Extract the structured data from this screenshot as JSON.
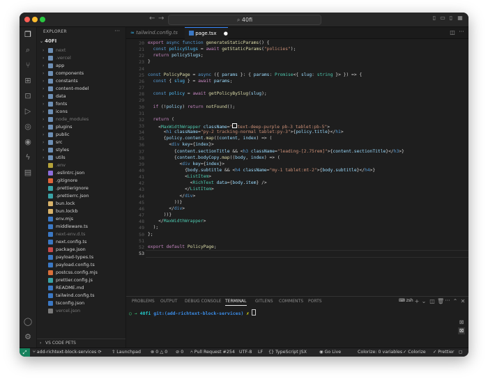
{
  "window": {
    "title": "40fi",
    "traffic": {
      "close": "#ff5f57",
      "min": "#febc2e",
      "max": "#28c840"
    }
  },
  "explorer": {
    "header": "EXPLORER",
    "root": "40FI",
    "items": [
      {
        "label": "next",
        "kind": "folder",
        "color": "#7a7a7a"
      },
      {
        "label": ".vercel",
        "kind": "folder",
        "color": "#7a7a7a"
      },
      {
        "label": "app",
        "kind": "folder",
        "color": "#d4d4d4"
      },
      {
        "label": "components",
        "kind": "folder",
        "color": "#d4d4d4"
      },
      {
        "label": "constants",
        "kind": "folder",
        "color": "#d4d4d4"
      },
      {
        "label": "content-model",
        "kind": "folder",
        "color": "#d4d4d4"
      },
      {
        "label": "data",
        "kind": "folder",
        "color": "#d4d4d4"
      },
      {
        "label": "fonts",
        "kind": "folder",
        "color": "#d4d4d4"
      },
      {
        "label": "icons",
        "kind": "folder",
        "color": "#d4d4d4"
      },
      {
        "label": "node_modules",
        "kind": "folder",
        "color": "#7a7a7a"
      },
      {
        "label": "plugins",
        "kind": "folder",
        "color": "#d4d4d4"
      },
      {
        "label": "public",
        "kind": "folder",
        "color": "#d4d4d4"
      },
      {
        "label": "src",
        "kind": "folder",
        "color": "#d4d4d4"
      },
      {
        "label": "styles",
        "kind": "folder",
        "color": "#d4d4d4"
      },
      {
        "label": "utils",
        "kind": "folder",
        "color": "#d4d4d4"
      },
      {
        "label": ".env",
        "kind": "file",
        "color": "#7a7a7a",
        "icon": "#b5a33a"
      },
      {
        "label": ".eslintrc.json",
        "kind": "file",
        "color": "#d4d4d4",
        "icon": "#8d6edb"
      },
      {
        "label": ".gitignore",
        "kind": "file",
        "color": "#d4d4d4",
        "icon": "#e0663b"
      },
      {
        "label": ".prettierignore",
        "kind": "file",
        "color": "#d4d4d4",
        "icon": "#3aa3a6"
      },
      {
        "label": ".prettierrc.json",
        "kind": "file",
        "color": "#d4d4d4",
        "icon": "#3aa3a6"
      },
      {
        "label": "bun.lock",
        "kind": "file",
        "color": "#d4d4d4",
        "icon": "#d9b36a"
      },
      {
        "label": "bun.lockb",
        "kind": "file",
        "color": "#d4d4d4",
        "icon": "#d9b36a"
      },
      {
        "label": "env.mjs",
        "kind": "file",
        "color": "#d4d4d4",
        "icon": "#3b78c4"
      },
      {
        "label": "middleware.ts",
        "kind": "file",
        "color": "#d4d4d4",
        "icon": "#3b78c4"
      },
      {
        "label": "next-env.d.ts",
        "kind": "file",
        "color": "#7a7a7a",
        "icon": "#3b78c4"
      },
      {
        "label": "next.config.ts",
        "kind": "file",
        "color": "#d4d4d4",
        "icon": "#3b78c4"
      },
      {
        "label": "package.json",
        "kind": "file",
        "color": "#d4d4d4",
        "icon": "#c94b4b"
      },
      {
        "label": "payload-types.ts",
        "kind": "file",
        "color": "#d4d4d4",
        "icon": "#3b78c4"
      },
      {
        "label": "payload.config.ts",
        "kind": "file",
        "color": "#d4d4d4",
        "icon": "#3b78c4"
      },
      {
        "label": "postcss.config.mjs",
        "kind": "file",
        "color": "#d4d4d4",
        "icon": "#d9703b"
      },
      {
        "label": "prettier.config.js",
        "kind": "file",
        "color": "#d4d4d4",
        "icon": "#3aa3a6"
      },
      {
        "label": "README.md",
        "kind": "file",
        "color": "#d4d4d4",
        "icon": "#3b78c4"
      },
      {
        "label": "tailwind.config.ts",
        "kind": "file",
        "color": "#d4d4d4",
        "icon": "#3b78c4"
      },
      {
        "label": "tsconfig.json",
        "kind": "file",
        "color": "#d4d4d4",
        "icon": "#3b78c4"
      },
      {
        "label": "vercel.json",
        "kind": "file",
        "color": "#7a7a7a",
        "icon": "#7a7a7a"
      }
    ],
    "footer": "VS CODE PETS"
  },
  "tabs": [
    {
      "label": "tailwind.config.ts",
      "active": false
    },
    {
      "label": "page.tsx",
      "active": true
    }
  ],
  "editor": {
    "active_line": "53",
    "lines": [
      {
        "n": "20",
        "html": "<span class='k'>export</span> <span class='kb'>async</span> <span class='kb'>function</span> <span class='f'>generateStaticParams</span>() {"
      },
      {
        "n": "21",
        "html": "  <span class='kb'>const</span> <span class='vc'>policySlugs</span> = <span class='k'>await</span> <span class='f'>getStaticParams</span>(<span class='s'>\"policies\"</span>);"
      },
      {
        "n": "22",
        "html": "  <span class='k'>return</span> <span class='v'>policySlugs</span>;"
      },
      {
        "n": "23",
        "html": "}"
      },
      {
        "n": "24",
        "html": ""
      },
      {
        "n": "25",
        "html": "<span class='kb'>const</span> <span class='f'>PolicyPage</span> = <span class='kb'>async</span> ({ <span class='v'>params</span> }: { <span class='v'>params</span>: <span class='t'>Promise</span>&lt;{ <span class='v'>slug</span>: <span class='t'>string</span> }&gt; }) =&gt; {"
      },
      {
        "n": "26",
        "html": "  <span class='kb'>const</span> { <span class='vc'>slug</span> } = <span class='k'>await</span> <span class='v'>params</span>;"
      },
      {
        "n": "27",
        "html": ""
      },
      {
        "n": "28",
        "html": "  <span class='kb'>const</span> <span class='vc'>policy</span> = <span class='k'>await</span> <span class='f'>getPolicyBySlug</span>(<span class='v'>slug</span>);"
      },
      {
        "n": "29",
        "html": ""
      },
      {
        "n": "30",
        "html": "  <span class='k'>if</span> (!<span class='v'>policy</span>) <span class='k'>return</span> <span class='f'>notFound</span>();"
      },
      {
        "n": "31",
        "html": ""
      },
      {
        "n": "32",
        "html": "  <span class='k'>return</span> ("
      },
      {
        "n": "33",
        "html": "    &lt;<span class='t'>MaxWidthWrapper</span> <span class='v'>className</span>=<span class='s'>\"</span><span style='display:inline-block;width:5px;height:5px;border:1px solid #fff;'></span><span class='s'>text-deep-purple pb-3 tablet:pb-5\"</span>&gt;"
      },
      {
        "n": "34",
        "html": "      &lt;<span class='kb'>h1</span> <span class='v'>className</span>=<span class='s'>\"py-2 tracking-normal tablet:py-3\"</span>&gt;{<span class='v'>policy</span>.<span class='v'>title</span>}&lt;/<span class='kb'>h1</span>&gt;"
      },
      {
        "n": "35",
        "html": "      {<span class='v'>policy</span>.<span class='v'>content</span>.<span class='f'>map</span>((<span class='v'>content</span>, <span class='v'>index</span>) =&gt; ("
      },
      {
        "n": "36",
        "html": "        &lt;<span class='kb'>div</span> <span class='v'>key</span>={<span class='v'>index</span>}&gt;"
      },
      {
        "n": "37",
        "html": "          {<span class='v'>content</span>.<span class='v'>sectionTitle</span> &amp;&amp; &lt;<span class='kb'>h3</span> <span class='v'>className</span>=<span class='s'>\"leading-[2.75rem]\"</span>&gt;{<span class='v'>content</span>.<span class='v'>sectionTitle</span>}&lt;/<span class='kb'>h3</span>&gt;}"
      },
      {
        "n": "38",
        "html": "          {<span class='v'>content</span>.<span class='v'>bodyCopy</span>.<span class='f'>map</span>((<span class='v'>body</span>, <span class='v'>index</span>) =&gt; ("
      },
      {
        "n": "39",
        "html": "            &lt;<span class='kb'>div</span> <span class='v'>key</span>={<span class='v'>index</span>}&gt;"
      },
      {
        "n": "40",
        "html": "              {<span class='v'>body</span>.<span class='v'>subtitle</span> &amp;&amp; &lt;<span class='kb'>h4</span> <span class='v'>className</span>=<span class='s'>\"my-1 tablet:mt-2\"</span>&gt;{<span class='v'>body</span>.<span class='v'>subtitle</span>}&lt;/<span class='kb'>h4</span>&gt;}"
      },
      {
        "n": "41",
        "html": "              &lt;<span class='t'>ListItem</span>&gt;"
      },
      {
        "n": "42",
        "html": "                &lt;<span class='t'>RichText</span> <span class='v'>data</span>={<span class='v'>body</span>.<span class='v'>item</span>} /&gt;"
      },
      {
        "n": "43",
        "html": "              &lt;/<span class='t'>ListItem</span>&gt;"
      },
      {
        "n": "44",
        "html": "            &lt;/<span class='kb'>div</span>&gt;"
      },
      {
        "n": "45",
        "html": "          ))}"
      },
      {
        "n": "46",
        "html": "        &lt;/<span class='kb'>div</span>&gt;"
      },
      {
        "n": "47",
        "html": "      ))}"
      },
      {
        "n": "48",
        "html": "    &lt;/<span class='t'>MaxWidthWrapper</span>&gt;"
      },
      {
        "n": "49",
        "html": "  );"
      },
      {
        "n": "50",
        "html": "};"
      },
      {
        "n": "51",
        "html": ""
      },
      {
        "n": "52",
        "html": "<span class='k'>export</span> <span class='k'>default</span> <span class='f'>PolicyPage</span>;"
      },
      {
        "n": "53",
        "html": ""
      }
    ]
  },
  "panel": {
    "tabs": [
      "PROBLEMS",
      "OUTPUT",
      "DEBUG CONSOLE",
      "TERMINAL",
      "GITLENS",
      "COMMENTS",
      "PORTS"
    ],
    "active_tab": "TERMINAL",
    "shell": "zsh",
    "prompt_dir": "40fi",
    "prompt_git": "git:(add-richtext-block-services)",
    "prompt_x": "✗"
  },
  "status": {
    "branch": "add-richtext-block-services",
    "launchpad": "Launchpad",
    "errors": "0",
    "warnings": "0",
    "ports": "0",
    "pull_request": "Pull Request #254",
    "encoding": "UTF-8",
    "eol": "LF",
    "language": "TypeScript JSX",
    "golive": "Go Live",
    "colorize_vars": "Colorize: 0 variables",
    "colorize": "Colorize",
    "prettier": "Prettier"
  }
}
